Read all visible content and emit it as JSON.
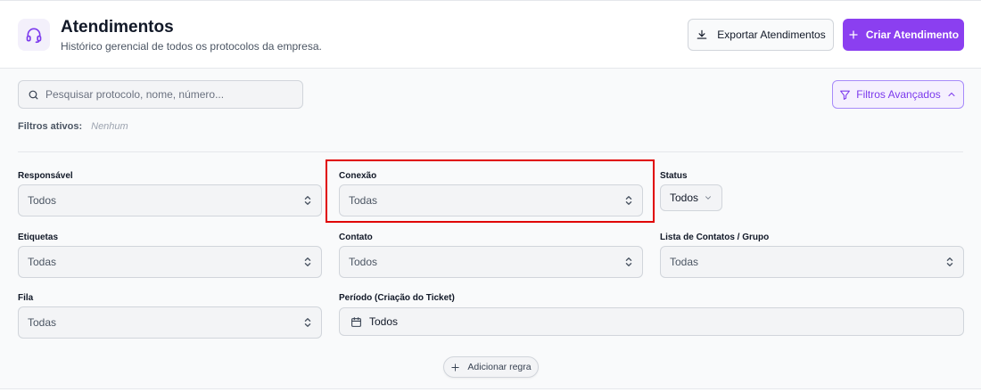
{
  "header": {
    "title": "Atendimentos",
    "subtitle": "Histórico gerencial de todos os protocolos da empresa.",
    "export_label": "Exportar Atendimentos",
    "create_label": "Criar Atendimento",
    "icon": "headset-icon"
  },
  "search": {
    "placeholder": "Pesquisar protocolo, nome, número...",
    "value": ""
  },
  "advanced_filters": {
    "label": "Filtros Avançados",
    "expanded": true
  },
  "active_filters": {
    "label": "Filtros ativos:",
    "value": "Nenhum"
  },
  "filters": {
    "responsavel": {
      "label": "Responsável",
      "value": "Todos"
    },
    "conexao": {
      "label": "Conexão",
      "value": "Todas"
    },
    "status": {
      "label": "Status",
      "value": "Todos"
    },
    "etiquetas": {
      "label": "Etiquetas",
      "value": "Todas"
    },
    "contato": {
      "label": "Contato",
      "value": "Todos"
    },
    "lista_contatos": {
      "label": "Lista de Contatos / Grupo",
      "value": "Todas"
    },
    "fila": {
      "label": "Fila",
      "value": "Todas"
    },
    "periodo": {
      "label": "Período (Criação do Ticket)",
      "value": "Todos"
    }
  },
  "add_rule_label": "Adicionar regra",
  "colors": {
    "accent": "#8b3ff0",
    "accent_light": "#f5f0fe",
    "highlight": "#e00000"
  }
}
